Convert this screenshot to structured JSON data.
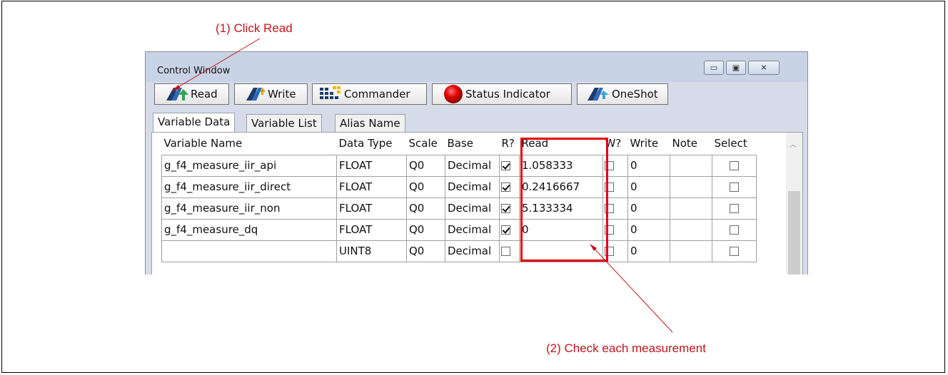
{
  "annotations": {
    "step1": "(1) Click Read",
    "step2": "(2) Check each measurement"
  },
  "window": {
    "title": "Control Window",
    "buttons": {
      "minimize": "▭",
      "maximize": "▣",
      "close": "✕"
    }
  },
  "toolbar": {
    "read_label": "Read",
    "write_label": "Write",
    "commander_label": "Commander",
    "status_label": "Status Indicator",
    "oneshot_label": "OneShot"
  },
  "tabs": [
    "Variable Data",
    "Variable List",
    "Alias Name"
  ],
  "table": {
    "headers": [
      "Variable Name",
      "Data Type",
      "Scale",
      "Base",
      "R?",
      "Read",
      "W?",
      "Write",
      "Note",
      "Select"
    ],
    "rows": [
      {
        "name": "g_f4_measure_iir_api",
        "type": "FLOAT",
        "scale": "Q0",
        "base": "Decimal",
        "r": true,
        "read": "1.058333",
        "w": false,
        "write": "0",
        "note": "",
        "select": false
      },
      {
        "name": "g_f4_measure_iir_direct",
        "type": "FLOAT",
        "scale": "Q0",
        "base": "Decimal",
        "r": true,
        "read": "0.2416667",
        "w": false,
        "write": "0",
        "note": "",
        "select": false
      },
      {
        "name": "g_f4_measure_iir_non",
        "type": "FLOAT",
        "scale": "Q0",
        "base": "Decimal",
        "r": true,
        "read": "5.133334",
        "w": false,
        "write": "0",
        "note": "",
        "select": false
      },
      {
        "name": "g_f4_measure_dq",
        "type": "FLOAT",
        "scale": "Q0",
        "base": "Decimal",
        "r": true,
        "read": "0",
        "w": false,
        "write": "0",
        "note": "",
        "select": false
      },
      {
        "name": "",
        "type": "UINT8",
        "scale": "Q0",
        "base": "Decimal",
        "r": false,
        "read": "",
        "w": false,
        "write": "0",
        "note": "",
        "select": false
      }
    ]
  },
  "colors": {
    "annotation": "#c0161d",
    "highlight": "#e5000b",
    "window_bg": "#d6dbe9"
  }
}
